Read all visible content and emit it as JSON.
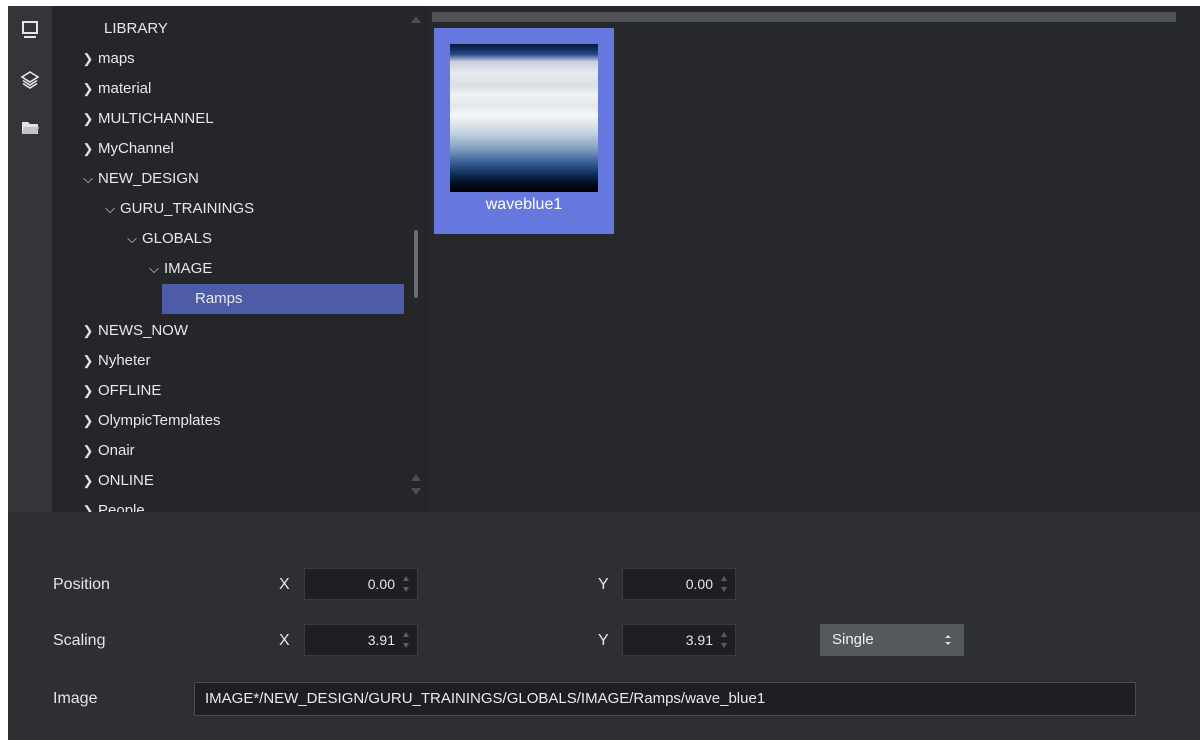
{
  "tree": {
    "items": [
      {
        "label": "LIBRARY",
        "chevron": ""
      },
      {
        "label": "maps",
        "chevron": "right"
      },
      {
        "label": "material",
        "chevron": "right"
      },
      {
        "label": "MULTICHANNEL",
        "chevron": "right"
      },
      {
        "label": "MyChannel",
        "chevron": "right"
      },
      {
        "label": "NEW_DESIGN",
        "chevron": "down"
      },
      {
        "label": "GURU_TRAININGS",
        "chevron": "down"
      },
      {
        "label": "GLOBALS",
        "chevron": "down"
      },
      {
        "label": "IMAGE",
        "chevron": "down"
      },
      {
        "label": "Ramps",
        "chevron": "",
        "selected": true
      },
      {
        "label": "NEWS_NOW",
        "chevron": "right"
      },
      {
        "label": "Nyheter",
        "chevron": "right"
      },
      {
        "label": "OFFLINE",
        "chevron": "right"
      },
      {
        "label": "OlympicTemplates",
        "chevron": "right"
      },
      {
        "label": "Onair",
        "chevron": "right"
      },
      {
        "label": "ONLINE",
        "chevron": "right"
      },
      {
        "label": "People",
        "chevron": "right"
      }
    ]
  },
  "assets": {
    "items": [
      {
        "name": "waveblue1",
        "selected": true
      }
    ]
  },
  "properties": {
    "position": {
      "label": "Position",
      "x_label": "X",
      "x": "0.00",
      "y_label": "Y",
      "y": "0.00"
    },
    "scaling": {
      "label": "Scaling",
      "x_label": "X",
      "x": "3.91",
      "y_label": "Y",
      "y": "3.91",
      "mode": "Single"
    },
    "image": {
      "label": "Image",
      "path": "IMAGE*/NEW_DESIGN/GURU_TRAININGS/GLOBALS/IMAGE/Ramps/wave_blue1"
    }
  },
  "icons": {
    "sidebar": [
      "monitor-icon",
      "layers-icon",
      "folder-icon"
    ]
  },
  "colors": {
    "selection": "#4e5ba6",
    "tile_selection": "#6677dd",
    "panel_bg": "#24262a"
  }
}
